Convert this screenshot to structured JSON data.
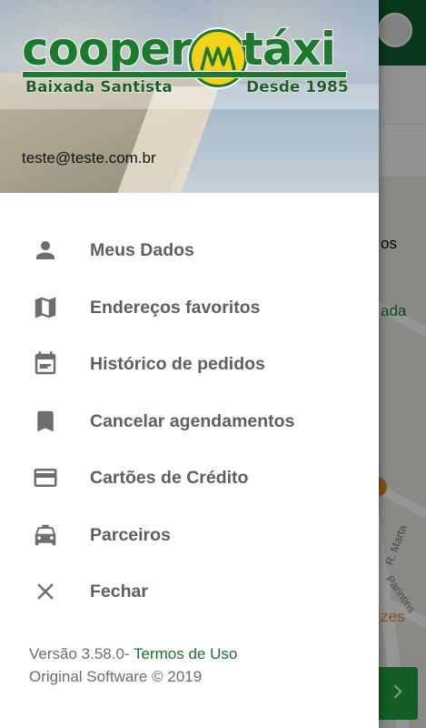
{
  "background": {
    "map_labels": [
      {
        "text": "os",
        "color": "#555555"
      },
      {
        "text": "ada",
        "color": "#1b7a2e"
      },
      {
        "text": "R. Marta",
        "color": "#777777"
      },
      {
        "text": "Parintins",
        "color": "#777777"
      },
      {
        "text": "zes",
        "color": "#e08a3c"
      }
    ],
    "next_icon": "chevron-right-icon"
  },
  "drawer": {
    "logo": {
      "word_left": "cooper",
      "word_right": "táxi",
      "subtitle_left": "Baixada Santista",
      "subtitle_right": "Desde 1985"
    },
    "email": "teste@teste.com.br",
    "menu": [
      {
        "label": "Meus Dados",
        "icon": "person-icon"
      },
      {
        "label": "Endereços favoritos",
        "icon": "map-icon"
      },
      {
        "label": "Histórico de pedidos",
        "icon": "calendar-icon"
      },
      {
        "label": "Cancelar agendamentos",
        "icon": "bookmark-icon"
      },
      {
        "label": "Cartões de Crédito",
        "icon": "credit-card-icon"
      },
      {
        "label": "Parceiros",
        "icon": "taxi-icon"
      },
      {
        "label": "Fechar",
        "icon": "close-icon"
      }
    ],
    "footer": {
      "version": "Versão 3.58.0-",
      "terms_link": " Termos de Uso",
      "copyright": "Original Software © 2019"
    }
  },
  "colors": {
    "brand_green": "#1b7a2e",
    "brand_yellow": "#f4d21c",
    "menu_text": "#5f5f5f",
    "icon_gray": "#6e6e6e"
  }
}
